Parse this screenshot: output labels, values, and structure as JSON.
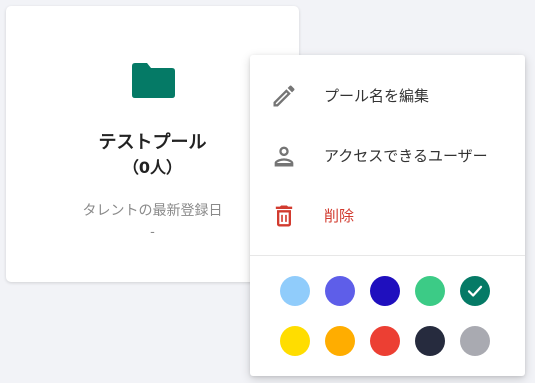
{
  "pool_card": {
    "name": "テストプール",
    "count": "（0人）",
    "last_registered_label": "タレントの最新登録日",
    "last_registered_value": "-",
    "icon": "folder-icon",
    "color": "#057a66"
  },
  "menu": {
    "items": [
      {
        "label": "プール名を編集",
        "icon": "pencil-icon"
      },
      {
        "label": "アクセスできるユーザー",
        "icon": "person-icon"
      },
      {
        "label": "削除",
        "icon": "trash-icon",
        "color": "#d23b2f"
      }
    ],
    "colors": [
      {
        "name": "light-blue",
        "hex": "#90ccfb",
        "selected": false
      },
      {
        "name": "periwinkle",
        "hex": "#5e5ee9",
        "selected": false
      },
      {
        "name": "indigo",
        "hex": "#1f0fbe",
        "selected": false
      },
      {
        "name": "green",
        "hex": "#3ccb86",
        "selected": false
      },
      {
        "name": "teal",
        "hex": "#057a66",
        "selected": true
      },
      {
        "name": "yellow",
        "hex": "#ffdd00",
        "selected": false
      },
      {
        "name": "orange",
        "hex": "#ffad00",
        "selected": false
      },
      {
        "name": "red",
        "hex": "#ec3f33",
        "selected": false
      },
      {
        "name": "navy",
        "hex": "#262b3e",
        "selected": false
      },
      {
        "name": "gray",
        "hex": "#a9aab1",
        "selected": false
      }
    ]
  }
}
